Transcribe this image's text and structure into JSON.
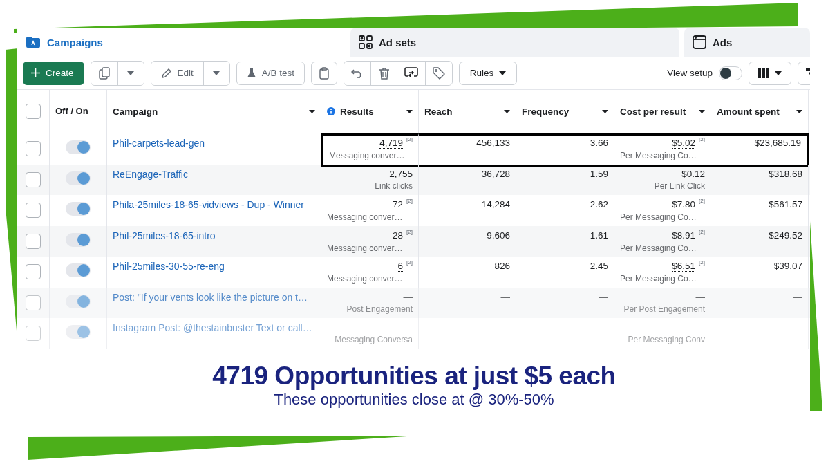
{
  "tabs": [
    {
      "label": "Campaigns",
      "kind": "campaigns",
      "selected": true
    },
    {
      "label": "Ad sets",
      "kind": "adsets",
      "selected": false
    },
    {
      "label": "Ads",
      "kind": "ads",
      "selected": false
    }
  ],
  "toolbar": {
    "create": "Create",
    "edit": "Edit",
    "ab_test": "A/B test",
    "rules": "Rules",
    "view_setup": {
      "label": "View setup",
      "on": false
    }
  },
  "table": {
    "select_all": {
      "checked": false
    },
    "columns": [
      "Off / On",
      "Campaign",
      "Results",
      "Reach",
      "Frequency",
      "Cost per result",
      "Amount spent"
    ],
    "rows": [
      {
        "checked": false,
        "on": true,
        "highlighted": true,
        "campaign": "Phil-carpets-lead-gen",
        "results": {
          "value": "4,719",
          "footnote": "[2]",
          "label": "Messaging conver…"
        },
        "reach": "456,133",
        "frequency": "3.66",
        "cost": {
          "value": "$5.02",
          "footnote": "[2]",
          "label": "Per Messaging Co…"
        },
        "amount": "$23,685.19"
      },
      {
        "checked": false,
        "on": true,
        "highlighted": false,
        "campaign": "ReEngage-Traffic",
        "results": {
          "value": "2,755",
          "label": "Link clicks"
        },
        "reach": "36,728",
        "frequency": "1.59",
        "cost": {
          "value": "$0.12",
          "label": "Per Link Click"
        },
        "amount": "$318.68"
      },
      {
        "checked": false,
        "on": true,
        "highlighted": false,
        "campaign": "Phila-25miles-18-65-vidviews - Dup - Winner",
        "results": {
          "value": "72",
          "footnote": "[2]",
          "label": "Messaging conver…"
        },
        "reach": "14,284",
        "frequency": "2.62",
        "cost": {
          "value": "$7.80",
          "footnote": "[2]",
          "label": "Per Messaging Co…"
        },
        "amount": "$561.57"
      },
      {
        "checked": false,
        "on": true,
        "highlighted": false,
        "campaign": "Phil-25miles-18-65-intro",
        "results": {
          "value": "28",
          "footnote": "[2]",
          "label": "Messaging conver…"
        },
        "reach": "9,606",
        "frequency": "1.61",
        "cost": {
          "value": "$8.91",
          "footnote": "[2]",
          "label": "Per Messaging Co…"
        },
        "amount": "$249.52"
      },
      {
        "checked": false,
        "on": true,
        "highlighted": false,
        "campaign": "Phil-25miles-30-55-re-eng",
        "results": {
          "value": "6",
          "footnote": "[2]",
          "label": "Messaging conver…"
        },
        "reach": "826",
        "frequency": "2.45",
        "cost": {
          "value": "$6.51",
          "footnote": "[2]",
          "label": "Per Messaging Co…"
        },
        "amount": "$39.07"
      },
      {
        "checked": false,
        "on": true,
        "highlighted": false,
        "campaign": "Post: \"If your vents look like the picture on t…",
        "results": {
          "value": "—",
          "label": "Post Engagement"
        },
        "reach": "—",
        "frequency": "—",
        "cost": {
          "value": "—",
          "label": "Per Post Engagement"
        },
        "amount": "—"
      },
      {
        "checked": false,
        "on": true,
        "highlighted": false,
        "campaign": "Instagram Post: @thestainbuster Text or call…",
        "results": {
          "value": "—",
          "label": "Messaging Conversa"
        },
        "reach": "—",
        "frequency": "—",
        "cost": {
          "value": "—",
          "label": "Per Messaging Conv"
        },
        "amount": "—"
      }
    ]
  },
  "caption": {
    "headline": "4719 Opportunities at just $5 each",
    "subline": "These opportunities close at @ 30%-50%"
  }
}
